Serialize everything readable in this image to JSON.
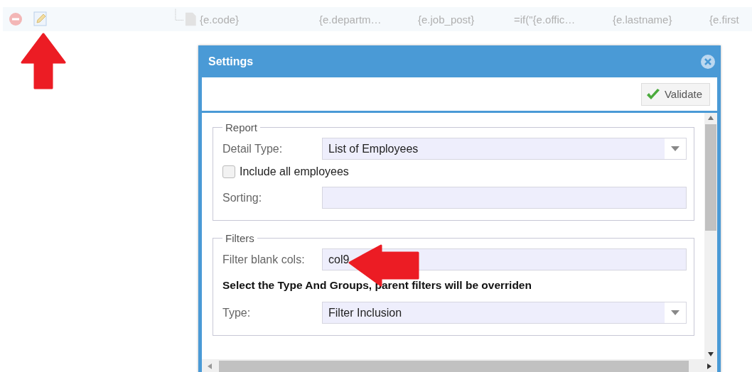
{
  "row": {
    "cells": [
      "{e.code}",
      "{e.departm…",
      "{e.job_post}",
      "=if(\"{e.offic…",
      "{e.lastname}",
      "{e.first"
    ]
  },
  "dialog": {
    "title": "Settings",
    "validate_button": "Validate",
    "sections": [
      {
        "legend": "Report",
        "fields": [
          {
            "kind": "select",
            "label": "Detail Type:",
            "value": "List of Employees"
          },
          {
            "kind": "checkbox",
            "label": "Include all employees",
            "checked": false
          },
          {
            "kind": "text",
            "label": "Sorting:"
          }
        ]
      },
      {
        "legend": "Filters",
        "fields": [
          {
            "kind": "text",
            "label": "Filter blank cols:",
            "value": "col9"
          },
          {
            "kind": "note",
            "text": "Select the Type And Groups, parent filters will be overriden"
          },
          {
            "kind": "select",
            "label": "Type:",
            "value": "Filter Inclusion"
          }
        ]
      }
    ]
  }
}
